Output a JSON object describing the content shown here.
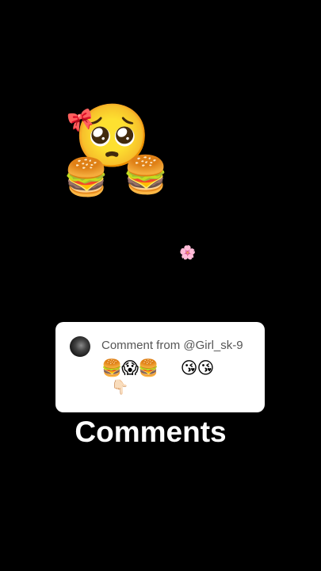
{
  "stickers": {
    "pleading_face": "🥺",
    "bow": "🎀",
    "burger_left": "🍔",
    "burger_right": "🍔",
    "kiss_left": "😘",
    "kiss_right": "😘",
    "flower": "🌸"
  },
  "comment": {
    "header": "Comment from @Girl_sk-9",
    "emoji_line": "🍔😱🍔     😘😘",
    "emoji_point": "👇🏻",
    "avatar_icon": "profile-avatar"
  },
  "caption": "Comments"
}
